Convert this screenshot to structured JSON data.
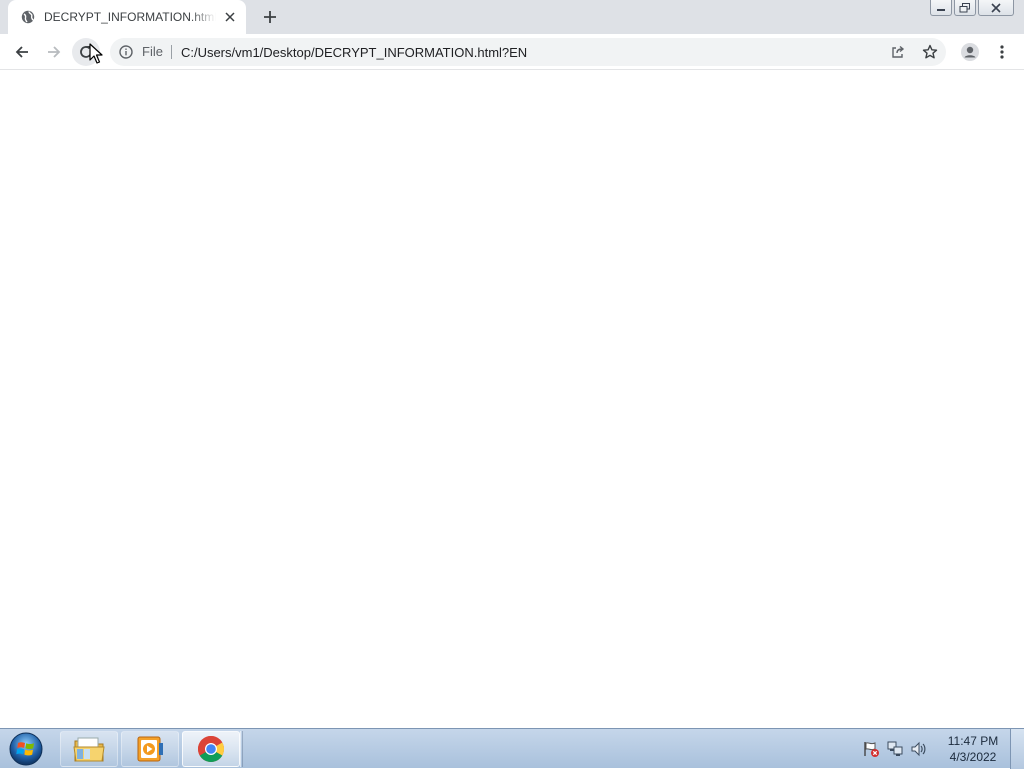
{
  "browser": {
    "tab": {
      "title": "DECRYPT_INFORMATION.html?EN",
      "favicon": "globe-icon"
    },
    "toolbar": {
      "scheme_label": "File",
      "url": "C:/Users/vm1/Desktop/DECRYPT_INFORMATION.html?EN"
    }
  },
  "taskbar": {
    "items": [
      {
        "name": "windows-explorer",
        "icon": "folder-icon"
      },
      {
        "name": "media-player",
        "icon": "media-player-icon"
      },
      {
        "name": "chrome",
        "icon": "chrome-icon",
        "active": true
      }
    ],
    "clock": {
      "time": "11:47 PM",
      "date": "4/3/2022"
    }
  },
  "colors": {
    "tabstrip": "#dee1e6",
    "omnibox": "#f1f3f4",
    "taskbar": "#b4c8e0",
    "icon": "#5f6368"
  }
}
